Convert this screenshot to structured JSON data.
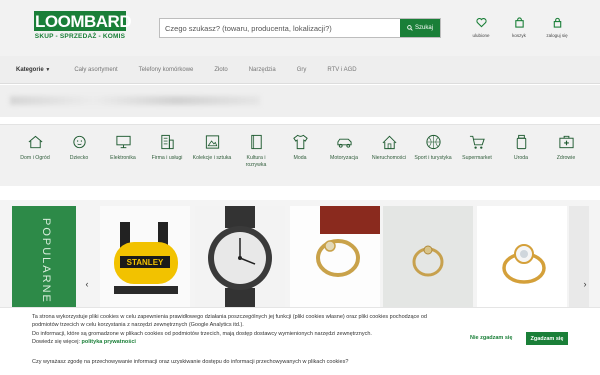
{
  "header": {
    "logo_text": "LOOMBARD",
    "logo_subtitle": "SKUP - SPRZEDAŻ - KOMIS",
    "search_placeholder": "Czego szukasz? (towaru, producenta, lokalizacji?)",
    "search_button": "Szukaj",
    "icons": [
      {
        "label": "ulubione",
        "icon": "heart-icon"
      },
      {
        "label": "koszyk",
        "icon": "bag-icon"
      },
      {
        "label": "zaloguj się",
        "icon": "lock-icon"
      }
    ]
  },
  "nav": {
    "items": [
      "Kategorie",
      "Cały asortyment",
      "Telefony komórkowe",
      "Złoto",
      "Narzędzia",
      "Gry",
      "RTV i AGD"
    ]
  },
  "categories": [
    {
      "label": "Dom i Ogród",
      "icon": "house-icon"
    },
    {
      "label": "Dziecko",
      "icon": "baby-icon"
    },
    {
      "label": "Elektronika",
      "icon": "monitor-icon"
    },
    {
      "label": "Firma i usługi",
      "icon": "building-icon"
    },
    {
      "label": "Kolekcje i sztuka",
      "icon": "frame-icon"
    },
    {
      "label": "Kultura i rozrywka",
      "icon": "book-icon"
    },
    {
      "label": "Moda",
      "icon": "shirt-icon"
    },
    {
      "label": "Motoryzacja",
      "icon": "car-icon"
    },
    {
      "label": "Nieruchomości",
      "icon": "home-icon"
    },
    {
      "label": "Sport i turystyka",
      "icon": "ball-icon"
    },
    {
      "label": "Supermarket",
      "icon": "cart-icon"
    },
    {
      "label": "Uroda",
      "icon": "bottle-icon"
    },
    {
      "label": "Zdrowie",
      "icon": "medkit-icon"
    }
  ],
  "popular_label": "POPULARNE",
  "cookie": {
    "text1": "Ta strona wykorzystuje pliki cookies w celu zapewnienia prawidłowego działania poszczególnych jej funkcji (pliki cookies własne) oraz pliki cookies pochodzące od podmiotów trzecich w celu korzystania z narzędzi zewnętrznych (Google Analytics itd.).",
    "text2": "Do informacji, które są gromadzone w plikach cookies od podmiotów trzecich, mają dostęp dostawcy wymienionych narzędzi zewnętrznych.",
    "text3_prefix": "Dowiedz się więcej:",
    "policy_link": "polityka prywatności",
    "question": "Czy wyrażasz zgodę na przechowywanie informacji oraz uzyskiwanie dostępu do informacji przechowywanych w plikach cookies?",
    "decline": "Nie zgadzam się",
    "accept": "Zgadzam się"
  },
  "colors": {
    "brand": "#1a7f38"
  }
}
